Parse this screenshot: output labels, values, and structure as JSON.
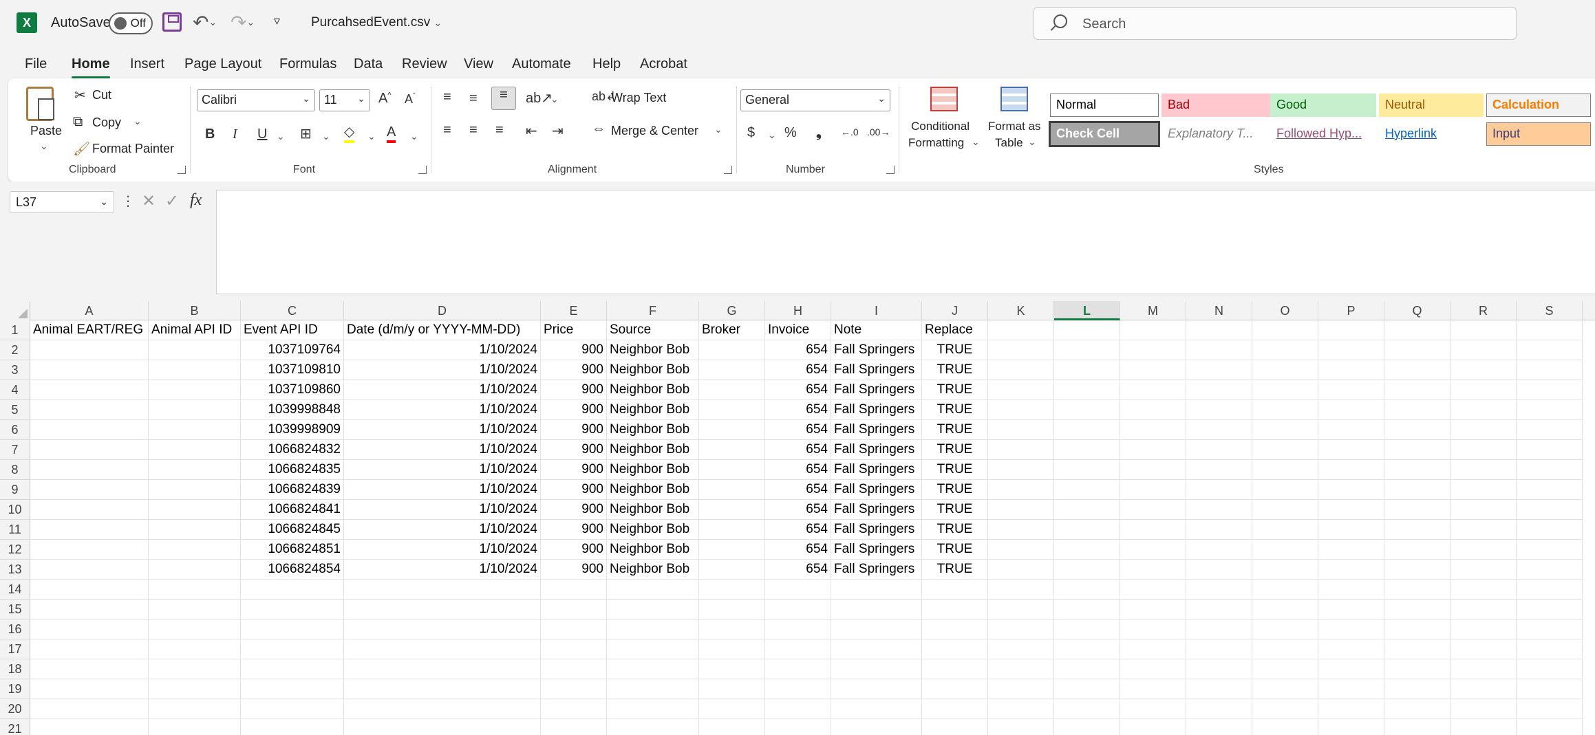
{
  "titlebar": {
    "app_icon": "excel-icon",
    "autosave_label": "AutoSave",
    "autosave_state": "Off",
    "file_name": "PurcahsedEvent.csv",
    "search_placeholder": "Search"
  },
  "menu": [
    "File",
    "Home",
    "Insert",
    "Page Layout",
    "Formulas",
    "Data",
    "Review",
    "View",
    "Automate",
    "Help",
    "Acrobat"
  ],
  "ribbon": {
    "clipboard": {
      "paste": "Paste",
      "cut": "Cut",
      "copy": "Copy",
      "format_painter": "Format Painter",
      "label": "Clipboard"
    },
    "font": {
      "name": "Calibri",
      "size": "11",
      "bold": "B",
      "italic": "I",
      "underline": "U",
      "label": "Font"
    },
    "alignment": {
      "wrap_text": "Wrap Text",
      "merge_center": "Merge & Center",
      "label": "Alignment"
    },
    "number": {
      "format": "General",
      "label": "Number"
    },
    "styles": {
      "conditional": [
        "Conditional",
        "Formatting"
      ],
      "format_table": [
        "Format as",
        "Table"
      ],
      "label": "Styles",
      "cells": [
        {
          "text": "Normal",
          "bg": "#ffffff",
          "fg": "#000000",
          "border": "#7a7a7a"
        },
        {
          "text": "Bad",
          "bg": "#ffc7ce",
          "fg": "#9c0006",
          "border": "#ffc7ce"
        },
        {
          "text": "Good",
          "bg": "#c6efce",
          "fg": "#006100",
          "border": "#c6efce"
        },
        {
          "text": "Neutral",
          "bg": "#ffeb9c",
          "fg": "#9c5700",
          "border": "#ffeb9c"
        },
        {
          "text": "Calculation",
          "bg": "#f2f2f2",
          "fg": "#fa7d00",
          "border": "#7f7f7f"
        },
        {
          "text": "Check Cell",
          "bg": "#a5a5a5",
          "fg": "#ffffff",
          "border": "#3f3f3f"
        },
        {
          "text": "Explanatory T...",
          "bg": "#ffffff",
          "fg": "#7f7f7f",
          "border": "#ffffff"
        },
        {
          "text": "Followed Hyp...",
          "bg": "#ffffff",
          "fg": "#954f72",
          "border": "#ffffff"
        },
        {
          "text": "Hyperlink",
          "bg": "#ffffff",
          "fg": "#0563c1",
          "border": "#ffffff"
        },
        {
          "text": "Input",
          "bg": "#ffcc99",
          "fg": "#3f3f76",
          "border": "#7f7f7f"
        }
      ]
    }
  },
  "formula_bar": {
    "name_box": "L37",
    "fx": "fx",
    "value": ""
  },
  "sheet": {
    "columns": [
      "A",
      "B",
      "C",
      "D",
      "E",
      "F",
      "G",
      "H",
      "I",
      "J",
      "K",
      "L",
      "M",
      "N",
      "O",
      "P",
      "Q",
      "R",
      "S"
    ],
    "selected_column": "L",
    "header_row": [
      "Animal EART/REG",
      "Animal API ID",
      "Event API ID",
      "Date (d/m/y or YYYY-MM-DD)",
      "Price",
      "Source",
      "Broker",
      "Invoice",
      "Note",
      "Replace"
    ],
    "rows": [
      [
        "",
        "",
        "1037109764",
        "1/10/2024",
        "900",
        "Neighbor Bob",
        "",
        "654",
        "Fall Springers",
        "TRUE"
      ],
      [
        "",
        "",
        "1037109810",
        "1/10/2024",
        "900",
        "Neighbor Bob",
        "",
        "654",
        "Fall Springers",
        "TRUE"
      ],
      [
        "",
        "",
        "1037109860",
        "1/10/2024",
        "900",
        "Neighbor Bob",
        "",
        "654",
        "Fall Springers",
        "TRUE"
      ],
      [
        "",
        "",
        "1039998848",
        "1/10/2024",
        "900",
        "Neighbor Bob",
        "",
        "654",
        "Fall Springers",
        "TRUE"
      ],
      [
        "",
        "",
        "1039998909",
        "1/10/2024",
        "900",
        "Neighbor Bob",
        "",
        "654",
        "Fall Springers",
        "TRUE"
      ],
      [
        "",
        "",
        "1066824832",
        "1/10/2024",
        "900",
        "Neighbor Bob",
        "",
        "654",
        "Fall Springers",
        "TRUE"
      ],
      [
        "",
        "",
        "1066824835",
        "1/10/2024",
        "900",
        "Neighbor Bob",
        "",
        "654",
        "Fall Springers",
        "TRUE"
      ],
      [
        "",
        "",
        "1066824839",
        "1/10/2024",
        "900",
        "Neighbor Bob",
        "",
        "654",
        "Fall Springers",
        "TRUE"
      ],
      [
        "",
        "",
        "1066824841",
        "1/10/2024",
        "900",
        "Neighbor Bob",
        "",
        "654",
        "Fall Springers",
        "TRUE"
      ],
      [
        "",
        "",
        "1066824845",
        "1/10/2024",
        "900",
        "Neighbor Bob",
        "",
        "654",
        "Fall Springers",
        "TRUE"
      ],
      [
        "",
        "",
        "1066824851",
        "1/10/2024",
        "900",
        "Neighbor Bob",
        "",
        "654",
        "Fall Springers",
        "TRUE"
      ],
      [
        "",
        "",
        "1066824854",
        "1/10/2024",
        "900",
        "Neighbor Bob",
        "",
        "654",
        "Fall Springers",
        "TRUE"
      ]
    ],
    "row_numbers": [
      "1",
      "2",
      "3",
      "4",
      "5",
      "6",
      "7",
      "8",
      "9",
      "10",
      "11",
      "12",
      "13",
      "14",
      "15",
      "16",
      "17",
      "18",
      "19",
      "20",
      "21"
    ]
  }
}
